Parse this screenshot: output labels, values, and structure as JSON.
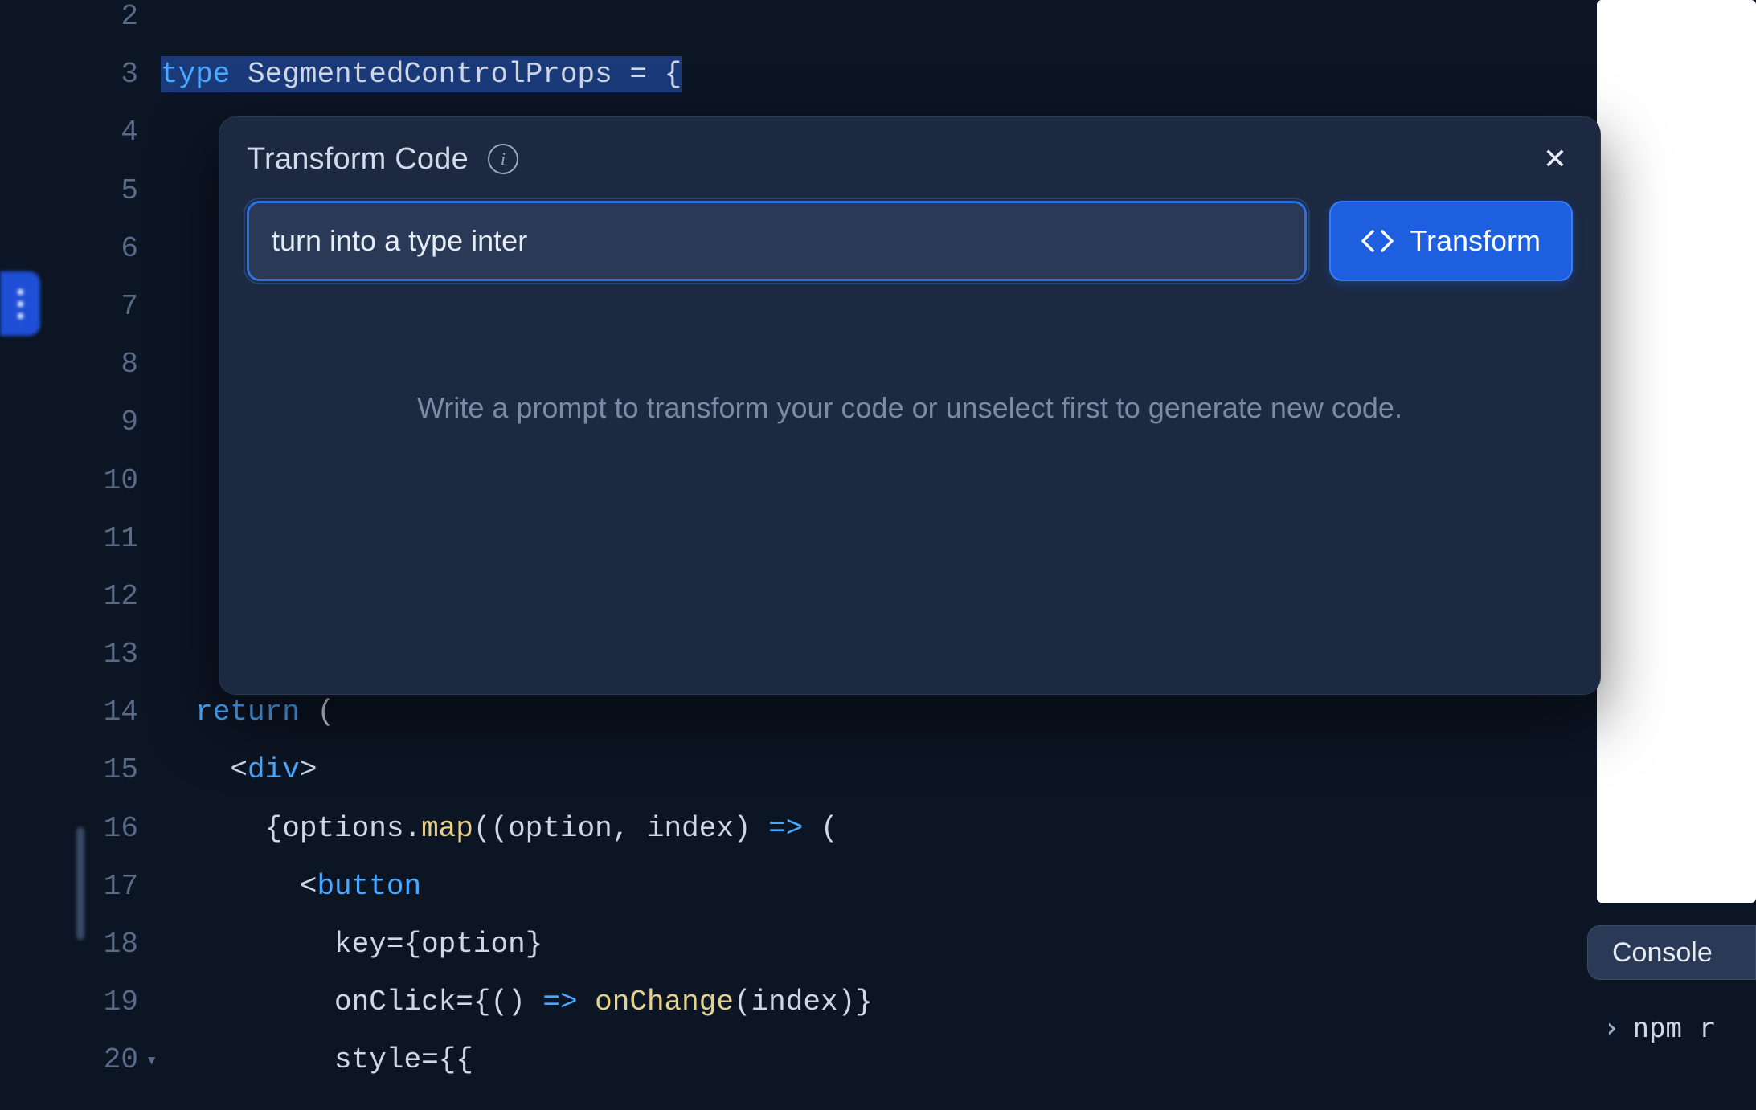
{
  "editor": {
    "lines": [
      {
        "n": "2",
        "tokens": []
      },
      {
        "n": "3",
        "selected": true,
        "tokens": [
          {
            "c": "t-kw",
            "t": "type "
          },
          {
            "c": "t-type",
            "t": "SegmentedControlProps"
          },
          {
            "c": "t-pun",
            "t": " = {"
          }
        ]
      },
      {
        "n": "4",
        "tokens": []
      },
      {
        "n": "5",
        "tokens": []
      },
      {
        "n": "6",
        "tokens": []
      },
      {
        "n": "7",
        "tokens": []
      },
      {
        "n": "8",
        "tokens": []
      },
      {
        "n": "9",
        "tokens": []
      },
      {
        "n": "10",
        "tokens": []
      },
      {
        "n": "11",
        "tokens": []
      },
      {
        "n": "12",
        "tokens": []
      },
      {
        "n": "13",
        "tokens": []
      },
      {
        "n": "14",
        "tokens": [
          {
            "c": "t-plain",
            "t": "  "
          },
          {
            "c": "t-kw",
            "t": "return"
          },
          {
            "c": "t-plain",
            "t": " ("
          }
        ]
      },
      {
        "n": "15",
        "tokens": [
          {
            "c": "t-plain",
            "t": "    "
          },
          {
            "c": "t-pun",
            "t": "<"
          },
          {
            "c": "t-tag",
            "t": "div"
          },
          {
            "c": "t-pun",
            "t": ">"
          }
        ]
      },
      {
        "n": "16",
        "tokens": [
          {
            "c": "t-plain",
            "t": "      {options."
          },
          {
            "c": "t-fn",
            "t": "map"
          },
          {
            "c": "t-plain",
            "t": "((option, index) "
          },
          {
            "c": "t-kw",
            "t": "=>"
          },
          {
            "c": "t-plain",
            "t": " ("
          }
        ]
      },
      {
        "n": "17",
        "tokens": [
          {
            "c": "t-plain",
            "t": "        "
          },
          {
            "c": "t-pun",
            "t": "<"
          },
          {
            "c": "t-tag",
            "t": "button"
          }
        ]
      },
      {
        "n": "18",
        "tokens": [
          {
            "c": "t-plain",
            "t": "          "
          },
          {
            "c": "t-attr",
            "t": "key"
          },
          {
            "c": "t-plain",
            "t": "={option}"
          }
        ]
      },
      {
        "n": "19",
        "tokens": [
          {
            "c": "t-plain",
            "t": "          "
          },
          {
            "c": "t-attr",
            "t": "onClick"
          },
          {
            "c": "t-plain",
            "t": "={() "
          },
          {
            "c": "t-kw",
            "t": "=>"
          },
          {
            "c": "t-plain",
            "t": " "
          },
          {
            "c": "t-call",
            "t": "onChange"
          },
          {
            "c": "t-plain",
            "t": "(index)}"
          }
        ]
      },
      {
        "n": "20",
        "fold": true,
        "tokens": [
          {
            "c": "t-plain",
            "t": "          "
          },
          {
            "c": "t-attr",
            "t": "style"
          },
          {
            "c": "t-plain",
            "t": "={{"
          }
        ]
      }
    ]
  },
  "popup": {
    "title": "Transform Code",
    "input_value": "turn into a type inter",
    "button_label": "Transform",
    "hint": "Write a prompt to transform your code or unselect first to generate new code."
  },
  "right": {
    "console_tab": "Console",
    "terminal_cmd": "npm r"
  },
  "icons": {
    "info_glyph": "i",
    "close_glyph": "✕",
    "prompt_chevron": "›",
    "fold_glyph": "▾"
  }
}
